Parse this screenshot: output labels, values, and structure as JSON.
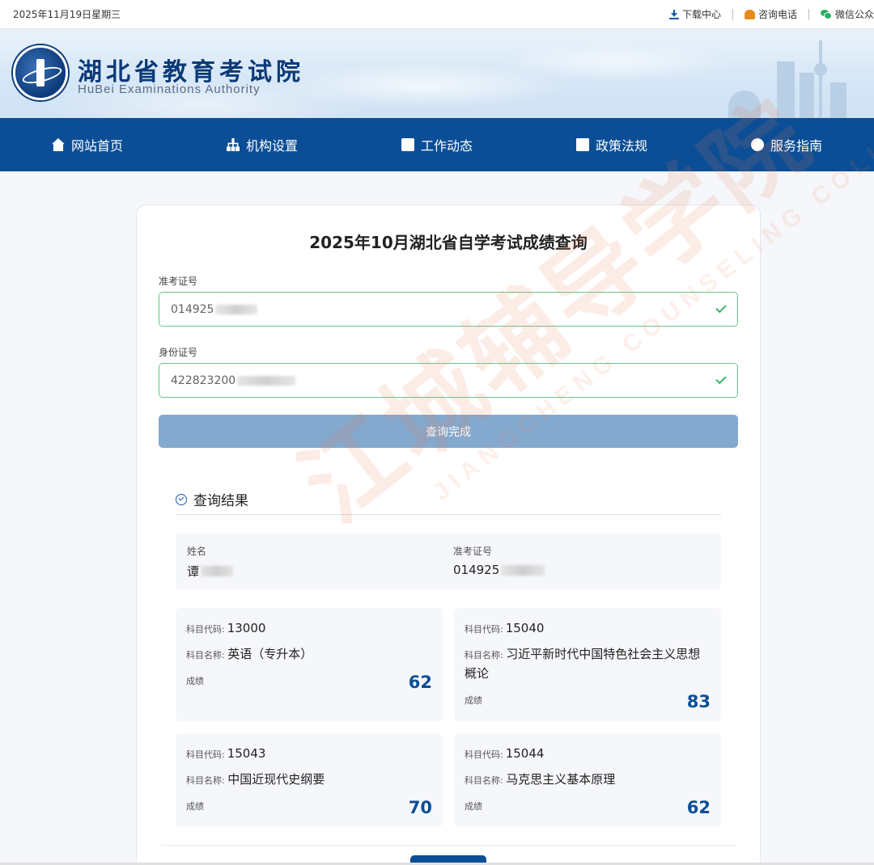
{
  "topbar": {
    "date": "2025年11月19日星期三",
    "links": [
      {
        "label": "下载中心",
        "icon": "download-icon"
      },
      {
        "label": "咨询电话",
        "icon": "phone-icon"
      },
      {
        "label": "微信公众",
        "icon": "wechat-icon"
      }
    ]
  },
  "header": {
    "title_cn": "湖北省教育考试院",
    "title_en": "HuBei Examinations Authority"
  },
  "nav": {
    "items": [
      {
        "label": "网站首页",
        "icon": "home-icon"
      },
      {
        "label": "机构设置",
        "icon": "org-chart-icon"
      },
      {
        "label": "工作动态",
        "icon": "news-icon"
      },
      {
        "label": "政策法规",
        "icon": "book-icon"
      },
      {
        "label": "服务指南",
        "icon": "compass-icon"
      }
    ]
  },
  "form": {
    "title": "2025年10月湖北省自学考试成绩查询",
    "exam_id_label": "准考证号",
    "exam_id_value": "014925",
    "id_card_label": "身份证号",
    "id_card_value": "422823200",
    "submit_label": "查询完成"
  },
  "result": {
    "heading": "查询结果",
    "name_label": "姓名",
    "name_value": "谭",
    "exam_id_label": "准考证号",
    "exam_id_value": "014925",
    "subjects": [
      {
        "code_label": "科目代码:",
        "code": "13000",
        "name_label": "科目名称:",
        "name": "英语（专升本）",
        "score_label": "成绩",
        "score": "62"
      },
      {
        "code_label": "科目代码:",
        "code": "15040",
        "name_label": "科目名称:",
        "name": "习近平新时代中国特色社会主义思想概论",
        "score_label": "成绩",
        "score": "83"
      },
      {
        "code_label": "科目代码:",
        "code": "15043",
        "name_label": "科目名称:",
        "name": "中国近现代史纲要",
        "score_label": "成绩",
        "score": "70"
      },
      {
        "code_label": "科目代码:",
        "code": "15044",
        "name_label": "科目名称:",
        "name": "马克思主义基本原理",
        "score_label": "成绩",
        "score": "62"
      }
    ]
  },
  "watermark": {
    "cn": "江城辅导学院",
    "en": "JIANGCHENG COUNSELING COLLEGE"
  },
  "colors": {
    "nav_bg": "#0b4e96",
    "accent": "#0b4e96",
    "valid_border": "#67c98b",
    "button_disabled": "#84a9cf"
  }
}
